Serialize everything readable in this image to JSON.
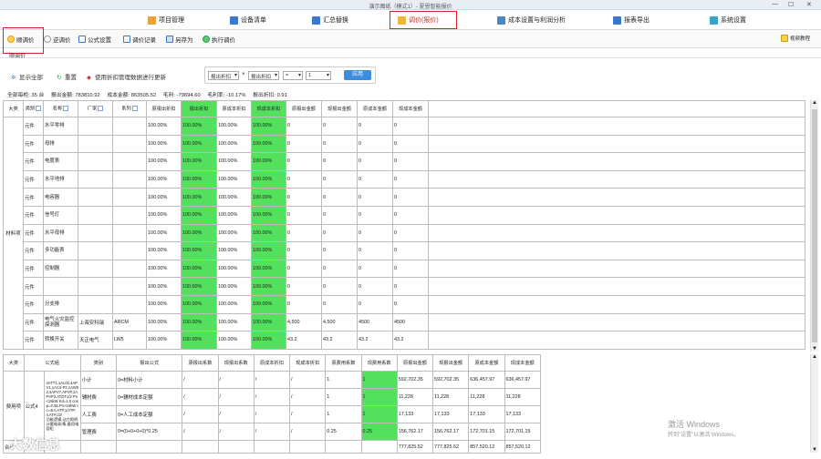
{
  "window": {
    "title": "演示图纸（模式1）- 夏恩智能报价",
    "minimize": "—",
    "maximize": "☐",
    "close": "✕"
  },
  "menu": [
    {
      "label": "项目管理",
      "color": "#e8a23a"
    },
    {
      "label": "设备清单",
      "color": "#3b78c8"
    },
    {
      "label": "汇总替换",
      "color": "#3b78c8"
    },
    {
      "label": "调价(报价)",
      "color": "#e8b83a"
    },
    {
      "label": "成本设置与利润分析",
      "color": "#4a86c8"
    },
    {
      "label": "报表导出",
      "color": "#3b78c8"
    },
    {
      "label": "系统设置",
      "color": "#3ba3c8"
    }
  ],
  "toolbar": {
    "items": [
      "顺调价",
      "逆调价",
      "公式设置",
      "调价记录",
      "另存为",
      "执行调价"
    ],
    "help": "视频教程"
  },
  "tab": "顺调价",
  "actions": {
    "show_all": "显示全部",
    "reset": "重置",
    "use_discount": "使用折扣管理数据进行更新"
  },
  "filter": {
    "field1": "报出折扣",
    "op1": "=",
    "field2": "报出折扣",
    "op2": "=",
    "value": "1",
    "apply": "应用"
  },
  "stats": [
    "全部每柜:  35 台",
    "报出金额: 783810.92",
    "成本金额: 863505.52",
    "毛利:  -79694.60",
    "毛利率:  -10.17%",
    "报出折扣: 0.91"
  ],
  "upper_table": {
    "headers": [
      "大类",
      "类别",
      "名称",
      "厂家",
      "系列",
      "原报出折扣",
      "报出折扣",
      "原成本折扣",
      "现成本折扣",
      "原报出金额",
      "现报出金额",
      "原成本金额",
      "现成本金额"
    ],
    "group_label": "材料项",
    "rows": [
      [
        "元件",
        "水平零排",
        "",
        "",
        "100.00%",
        "100.00%",
        "100.00%",
        "100.00%",
        "0",
        "0",
        "0",
        "0"
      ],
      [
        "元件",
        "母排",
        "",
        "",
        "100.00%",
        "100.00%",
        "100.00%",
        "100.00%",
        "0",
        "0",
        "0",
        "0"
      ],
      [
        "元件",
        "电度表",
        "",
        "",
        "100.00%",
        "100.00%",
        "100.00%",
        "100.00%",
        "0",
        "0",
        "0",
        "0"
      ],
      [
        "元件",
        "水平地排",
        "",
        "",
        "100.00%",
        "100.00%",
        "100.00%",
        "100.00%",
        "0",
        "0",
        "0",
        "0"
      ],
      [
        "元件",
        "电容器",
        "",
        "",
        "100.00%",
        "100.00%",
        "100.00%",
        "100.00%",
        "0",
        "0",
        "0",
        "0"
      ],
      [
        "元件",
        "信号灯",
        "",
        "",
        "100.00%",
        "100.00%",
        "100.00%",
        "100.00%",
        "0",
        "0",
        "0",
        "0"
      ],
      [
        "元件",
        "水平母排",
        "",
        "",
        "100.00%",
        "100.00%",
        "100.00%",
        "100.00%",
        "0",
        "0",
        "0",
        "0"
      ],
      [
        "元件",
        "多功能表",
        "",
        "",
        "100.00%",
        "100.00%",
        "100.00%",
        "100.00%",
        "0",
        "0",
        "0",
        "0"
      ],
      [
        "元件",
        "控制器",
        "",
        "",
        "100.00%",
        "100.00%",
        "100.00%",
        "100.00%",
        "0",
        "0",
        "0",
        "0"
      ],
      [
        "元件",
        "",
        "",
        "",
        "100.00%",
        "100.00%",
        "100.00%",
        "100.00%",
        "0",
        "0",
        "0",
        "0"
      ],
      [
        "元件",
        "分支排",
        "",
        "",
        "100.00%",
        "100.00%",
        "100.00%",
        "100.00%",
        "0",
        "0",
        "0",
        "0"
      ],
      [
        "元件",
        "电气火灾监控探测器",
        "上海安科瑞",
        "ARCM",
        "100.00%",
        "100.00%",
        "100.00%",
        "100.00%",
        "4,500",
        "4,500",
        "4500",
        "4500"
      ],
      [
        "元件",
        "转换开关",
        "天正电气",
        "LW5",
        "100.00%",
        "100.00%",
        "100.00%",
        "100.00%",
        "43.2",
        "43.2",
        "43.2",
        "43.2"
      ]
    ]
  },
  "lower_table": {
    "headers": [
      "大类",
      "公式组",
      "",
      "类别",
      "报出公式",
      "原报出系数",
      "现报出系数",
      "原成本折扣",
      "现成本折扣",
      "原费用系数",
      "现费用系数",
      "原报出金额",
      "现报出金额",
      "原成本金额",
      "现成本金额"
    ],
    "group_label": "费用项",
    "formula_group": "公式4",
    "conditions": "4ATT1,1AL02,4APV1,1AC4-P2,1AW52,4APV7,APVP,1APVP2,ATDT1/2 Pn<15kW Kd=1.0 cosφ=0.55 Pn>15kW Ic=4IA,ATP,1/ATP;4,ATP,J2/",
    "sub_label": "功能逻辑,动力照明,计量电表/集,备用电容柜",
    "rows": [
      [
        "小计",
        "0=材料小计",
        "/",
        "/",
        "/",
        "/",
        "1",
        "1",
        "592,702.35",
        "592,702.35",
        "636,457.97",
        "636,457.97"
      ],
      [
        "辅材费",
        "0=辅材成本定额",
        "/",
        "/",
        "/",
        "/",
        "1",
        "1",
        "11,228",
        "11,228",
        "11,228",
        "11,228"
      ],
      [
        "人工费",
        "0=人工成本定额",
        "/",
        "/",
        "/",
        "/",
        "1",
        "1",
        "17,133",
        "17,133",
        "17,133",
        "17,133"
      ],
      [
        "管理费",
        "0=(0+0+0+0)*0.25",
        "/",
        "/",
        "/",
        "/",
        "0.25",
        "0.25",
        "156,762.17",
        "156,762.17",
        "172,701.15",
        "172,701.15"
      ]
    ],
    "total_label": "合计",
    "totals": [
      "777,825.52",
      "777,825.52",
      "857,520.12",
      "857,520.12"
    ]
  },
  "watermark": {
    "activate_title": "激活 Windows",
    "activate_sub": "转到\"设置\"以激活 Windows。",
    "logo": "大数信息"
  }
}
